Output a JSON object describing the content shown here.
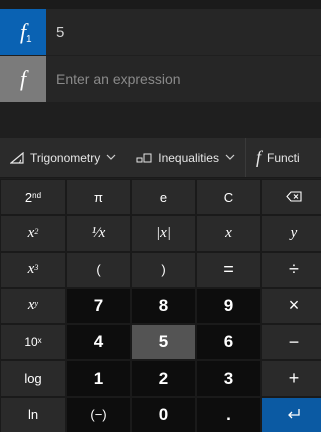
{
  "functions": [
    {
      "icon": "f",
      "subscript": "1",
      "value": "5"
    },
    {
      "icon": "f",
      "placeholder": "Enter an expression"
    }
  ],
  "toolbar": {
    "trigonometry": "Trigonometry",
    "inequalities": "Inequalities",
    "function": "Functi"
  },
  "keys": {
    "second": "2",
    "second_sup": "nd",
    "pi": "π",
    "e": "e",
    "clear": "C",
    "backspace": "⌫",
    "x2_base": "x",
    "x2_sup": "2",
    "reciprocal": "¹⁄x",
    "abs": "|x|",
    "x_var": "x",
    "y_var": "y",
    "x3_base": "x",
    "x3_sup": "3",
    "lparen": "(",
    "rparen": ")",
    "equals": "=",
    "divide": "÷",
    "xy_base": "x",
    "xy_sup": "y",
    "n7": "7",
    "n8": "8",
    "n9": "9",
    "multiply": "×",
    "ten_x_base": "10",
    "ten_x_sup": "x",
    "n4": "4",
    "n5": "5",
    "n6": "6",
    "minus": "−",
    "log": "log",
    "n1": "1",
    "n2": "2",
    "n3": "3",
    "plus": "+",
    "ln": "ln",
    "negate": "(−)",
    "n0": "0",
    "dot": ".",
    "enter": "↵"
  },
  "colors": {
    "accent": "#0a62b3",
    "enter": "#0b5aa3",
    "function_icon_inactive": "#7b7b7b",
    "highlight_key": "#545454"
  }
}
